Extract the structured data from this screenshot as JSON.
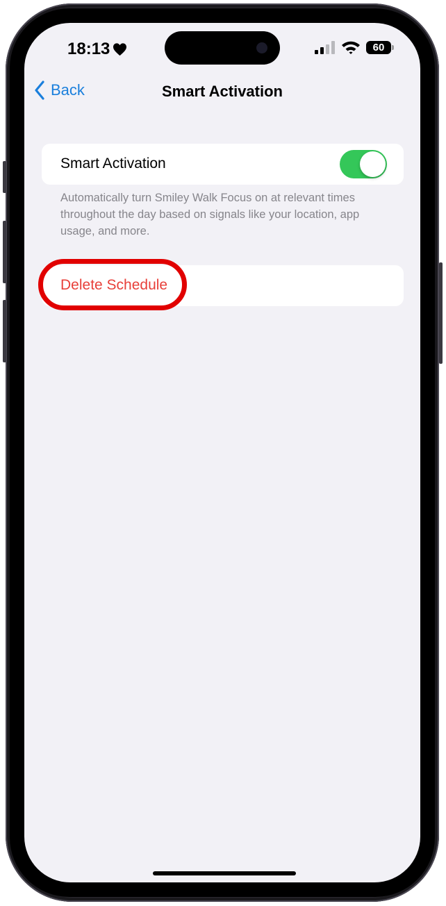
{
  "status_bar": {
    "time": "18:13",
    "battery": "60"
  },
  "nav": {
    "back_label": "Back",
    "title": "Smart Activation"
  },
  "smart_activation": {
    "label": "Smart Activation",
    "enabled": true,
    "footnote": "Automatically turn Smiley Walk Focus on at relevant times throughout the day based on signals like your location, app usage, and more."
  },
  "actions": {
    "delete_label": "Delete Schedule"
  },
  "colors": {
    "accent": "#1a7fdc",
    "toggle_on": "#34c759",
    "destructive": "#e8403a",
    "annotation": "#e10000",
    "background": "#f2f1f6"
  }
}
